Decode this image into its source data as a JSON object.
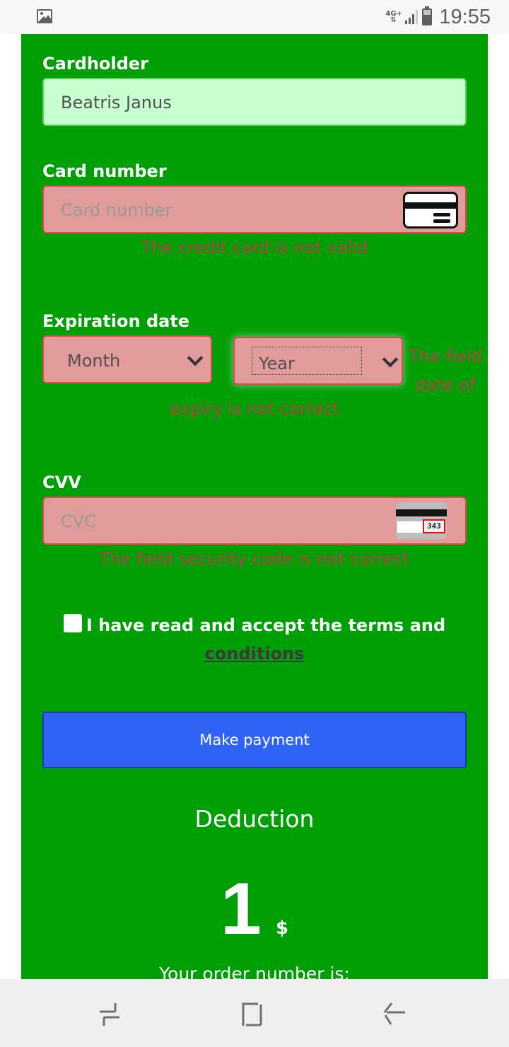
{
  "status_bar": {
    "left_icon": "image-icon",
    "network": "4G+",
    "time": "19:55"
  },
  "form": {
    "cardholder": {
      "label": "Cardholder",
      "value": "Beatris Janus"
    },
    "card_number": {
      "label": "Card number",
      "placeholder": "Card number",
      "icon": "credit-card-icon",
      "error": "The credit card is not valid"
    },
    "expiration": {
      "label": "Expiration date",
      "month_selected": "Month",
      "year_selected": "Year",
      "error_line1": "The field",
      "error_line2": "date of",
      "error_line3": "expiry is not correct"
    },
    "cvv": {
      "label": "CVV",
      "placeholder": "CVC",
      "icon": "cvv-card-icon",
      "icon_code": "343",
      "error": "The field security code is not correct"
    },
    "terms": {
      "checked": false,
      "text": "I have read and accept the terms and",
      "link": "conditions"
    },
    "submit_label": "Make payment"
  },
  "summary": {
    "title": "Deduction",
    "amount": "1",
    "currency": "$",
    "order_label": "Your order number is:"
  },
  "colors": {
    "page_bg": "#009f05",
    "error_field_bg": "#e29b9b",
    "error_border": "#e04848",
    "error_text": "#b34242",
    "valid_field_bg": "#c7ffd1",
    "button": "#2f63f5"
  },
  "nav_bar": {
    "buttons": [
      "recent-apps",
      "home",
      "back"
    ]
  }
}
